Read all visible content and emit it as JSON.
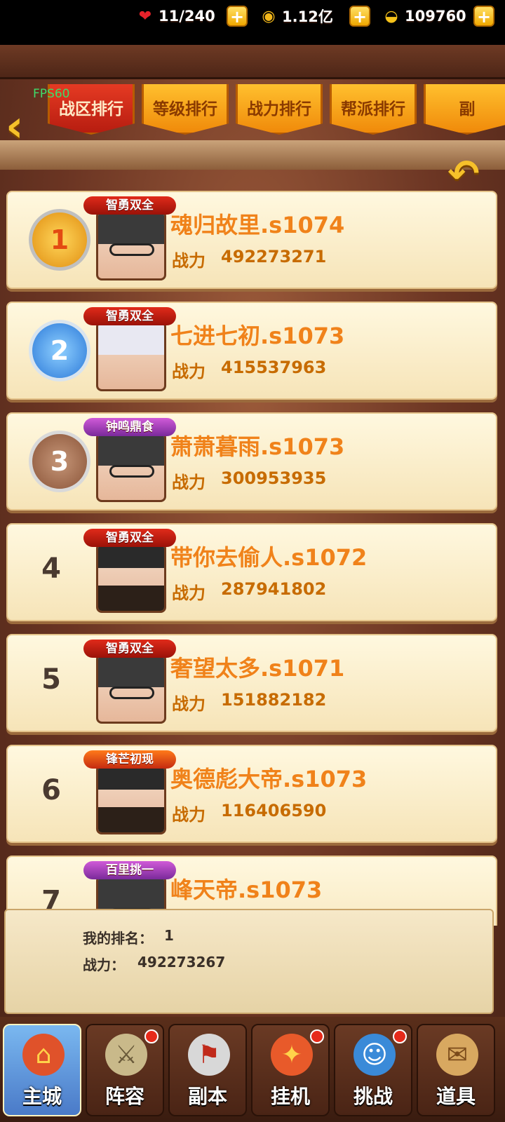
{
  "resources": {
    "stamina": "11/240",
    "coins": "1.12亿",
    "ingots": "109760",
    "plus": "+"
  },
  "debug": {
    "fps": "FPS60"
  },
  "tabs": [
    {
      "label": "战区排行",
      "active": true
    },
    {
      "label": "等级排行",
      "active": false
    },
    {
      "label": "战力排行",
      "active": false
    },
    {
      "label": "帮派排行",
      "active": false
    },
    {
      "label": "副",
      "active": false
    }
  ],
  "power_label": "战力",
  "rows": [
    {
      "rank": "1",
      "badge": "智勇双全",
      "name": "魂归故里.s1074",
      "power": "492273271"
    },
    {
      "rank": "2",
      "badge": "智勇双全",
      "name": "七进七初.s1073",
      "power": "415537963"
    },
    {
      "rank": "3",
      "badge": "钟鸣鼎食",
      "name": "萧萧暮雨.s1073",
      "power": "300953935"
    },
    {
      "rank": "4",
      "badge": "智勇双全",
      "name": "带你去偷人.s1072",
      "power": "287941802"
    },
    {
      "rank": "5",
      "badge": "智勇双全",
      "name": "奢望太多.s1071",
      "power": "151882182"
    },
    {
      "rank": "6",
      "badge": "锋芒初现",
      "name": "奥德彪大帝.s1073",
      "power": "116406590"
    },
    {
      "rank": "7",
      "badge": "百里挑一",
      "name": "峰天帝.s1073",
      "power": ""
    }
  ],
  "my_rank": {
    "rank_label": "我的排名：",
    "rank_value": "1",
    "power_label": "战力：",
    "power_value": "492273267"
  },
  "nav": [
    {
      "label": "主城",
      "icon": "castle-icon"
    },
    {
      "label": "阵容",
      "icon": "lineup-icon"
    },
    {
      "label": "副本",
      "icon": "dungeon-icon"
    },
    {
      "label": "挂机",
      "icon": "idle-icon"
    },
    {
      "label": "挑战",
      "icon": "challenge-icon"
    },
    {
      "label": "道具",
      "icon": "items-icon"
    }
  ]
}
